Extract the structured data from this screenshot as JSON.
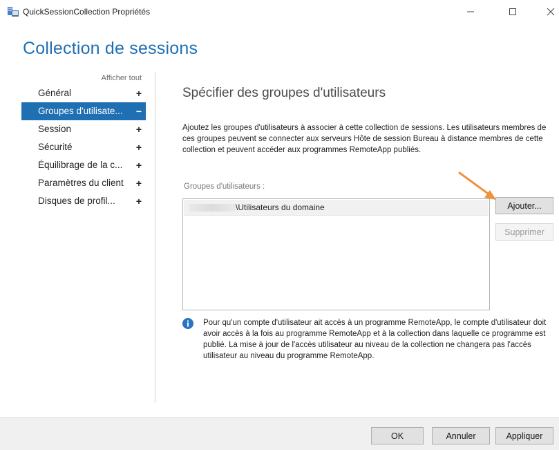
{
  "window": {
    "title": "QuickSessionCollection Propriétés",
    "icon": "server-app-icon",
    "controls": {
      "minimize": "minimize-icon",
      "maximize": "maximize-icon",
      "close": "close-icon"
    }
  },
  "header": {
    "title": "Collection de sessions"
  },
  "sidebar": {
    "show_all": "Afficher tout",
    "items": [
      {
        "label": "Général",
        "sign": "+",
        "active": false
      },
      {
        "label": "Groupes d'utilisate...",
        "sign": "−",
        "active": true
      },
      {
        "label": "Session",
        "sign": "+",
        "active": false
      },
      {
        "label": "Sécurité",
        "sign": "+",
        "active": false
      },
      {
        "label": "Équilibrage de la c...",
        "sign": "+",
        "active": false
      },
      {
        "label": "Paramètres du client",
        "sign": "+",
        "active": false
      },
      {
        "label": "Disques de profil...",
        "sign": "+",
        "active": false
      }
    ]
  },
  "content": {
    "section_title": "Spécifier des groupes d'utilisateurs",
    "description": "Ajoutez les groupes d'utilisateurs à associer à cette collection de sessions. Les utilisateurs membres de ces groupes peuvent se connecter aux serveurs Hôte de session Bureau à distance membres de cette collection et peuvent accéder aux programmes RemoteApp publiés.",
    "groups_label": "Groupes d'utilisateurs :",
    "groups": [
      {
        "name": "\\Utilisateurs du domaine"
      }
    ],
    "add_button": "Ajouter...",
    "remove_button": "Supprimer",
    "info_icon": "info-icon",
    "info_text": "Pour qu'un compte d'utilisateur ait accès à un programme RemoteApp, le compte d'utilisateur doit avoir accès à la fois au programme RemoteApp et à la collection dans laquelle ce programme est publié. La mise à jour de l'accès utilisateur au niveau de la collection ne changera pas l'accès utilisateur au niveau du programme RemoteApp."
  },
  "footer": {
    "ok": "OK",
    "cancel": "Annuler",
    "apply": "Appliquer"
  },
  "colors": {
    "accent": "#1f6fb3",
    "annotation_arrow": "#f0923a",
    "footer_bg": "#f0f0f0"
  }
}
